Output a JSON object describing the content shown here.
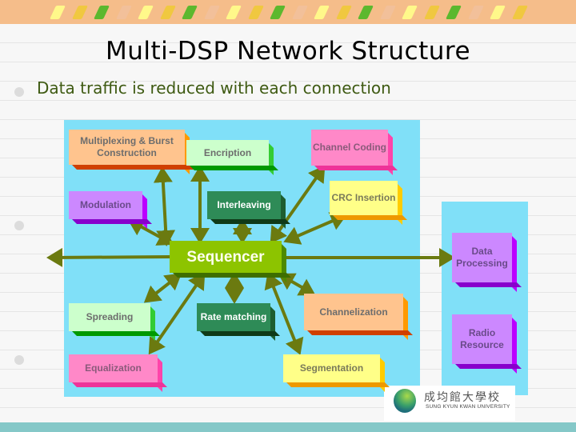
{
  "slide": {
    "title": "Multi-DSP Network Structure",
    "bullet": "Data traffic is reduced with each connection"
  },
  "diagram": {
    "center": {
      "label": "Sequencer",
      "color": "#8dc400"
    },
    "connector_color": "#6b7a10",
    "panel_color": "#80e0f8",
    "nodes": [
      {
        "id": "mux",
        "label": "Multiplexing & Burst Construction",
        "face": "#ffc48e",
        "side": "#ff9900",
        "bottom": "#d04000",
        "text": "#6d6d6d"
      },
      {
        "id": "encription",
        "label": "Encription",
        "face": "#ccffcc",
        "side": "#33cc33",
        "bottom": "#009900",
        "text": "#6d6d6d"
      },
      {
        "id": "channel-coding",
        "label": "Channel Coding",
        "face": "#ff88c8",
        "side": "#ff44aa",
        "bottom": "#ee3399",
        "text": "#8a5a7a"
      },
      {
        "id": "modulation",
        "label": "Modulation",
        "face": "#cc88ff",
        "side": "#bb00ff",
        "bottom": "#8800cc",
        "text": "#6a4a8a"
      },
      {
        "id": "interleaving",
        "label": "Interleaving",
        "face": "#2e8b57",
        "side": "#1e5e30",
        "bottom": "#0f3a18",
        "text": "#ffffff"
      },
      {
        "id": "crc",
        "label": "CRC Insertion",
        "face": "#ffff88",
        "side": "#ffcc00",
        "bottom": "#ee9900",
        "text": "#7a7a5a"
      },
      {
        "id": "spreading",
        "label": "Spreading",
        "face": "#ccffcc",
        "side": "#33cc33",
        "bottom": "#009900",
        "text": "#6d6d6d"
      },
      {
        "id": "rate-matching",
        "label": "Rate matching",
        "face": "#2e8b57",
        "side": "#1e5e30",
        "bottom": "#0f3a18",
        "text": "#ffffff"
      },
      {
        "id": "channelization",
        "label": "Channelization",
        "face": "#ffc48e",
        "side": "#ff9900",
        "bottom": "#d04000",
        "text": "#6d6d6d"
      },
      {
        "id": "equalization",
        "label": "Equalization",
        "face": "#ff88c8",
        "side": "#ff44aa",
        "bottom": "#ee3399",
        "text": "#8a5a7a"
      },
      {
        "id": "segmentation",
        "label": "Segmentation",
        "face": "#ffff88",
        "side": "#ffcc00",
        "bottom": "#ee9900",
        "text": "#7a7a5a"
      },
      {
        "id": "data-processing",
        "label": "Data Processing",
        "face": "#cc88ff",
        "side": "#bb00ff",
        "bottom": "#8800cc",
        "text": "#6a4a8a"
      },
      {
        "id": "radio-resource",
        "label": "Radio Resource",
        "face": "#cc88ff",
        "side": "#bb00ff",
        "bottom": "#8800cc",
        "text": "#6a4a8a"
      }
    ]
  },
  "logo": {
    "name_cn": "成均館大學校",
    "name_en": "SUNG KYUN KWAN UNIVERSITY"
  }
}
